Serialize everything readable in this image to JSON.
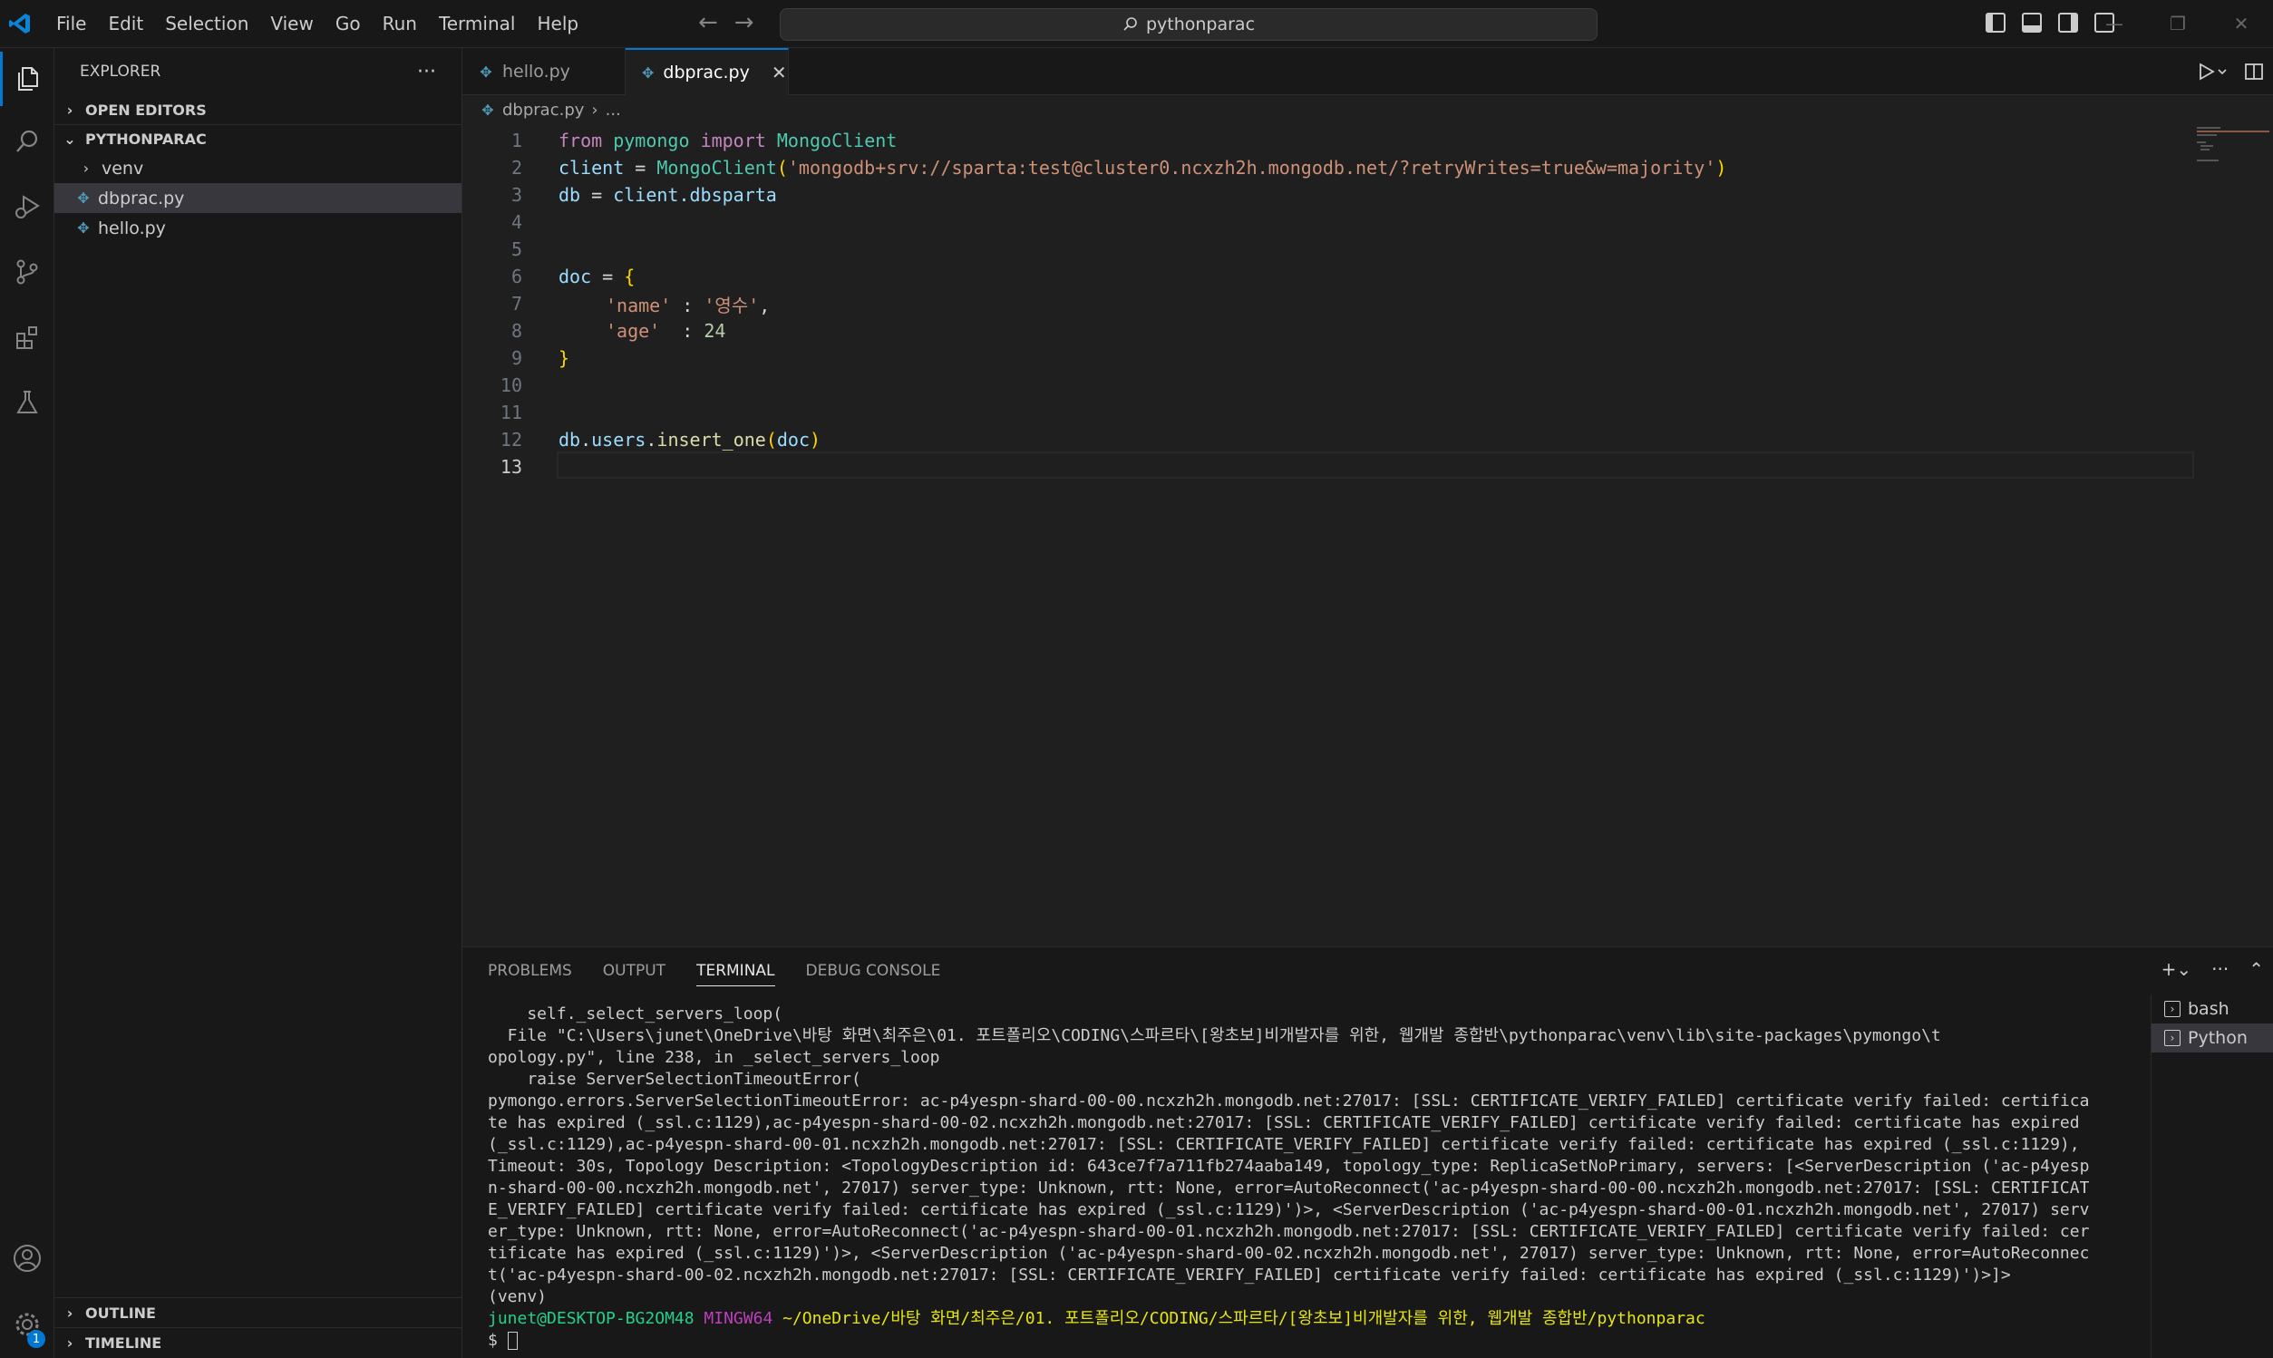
{
  "titlebar": {
    "menu": [
      "File",
      "Edit",
      "Selection",
      "View",
      "Go",
      "Run",
      "Terminal",
      "Help"
    ],
    "search_text": "pythonparac"
  },
  "sidebar": {
    "title": "EXPLORER",
    "open_editors": "OPEN EDITORS",
    "project": "PYTHONPARAC",
    "items": [
      {
        "label": "venv",
        "kind": "folder"
      },
      {
        "label": "dbprac.py",
        "kind": "file",
        "selected": true
      },
      {
        "label": "hello.py",
        "kind": "file"
      }
    ],
    "outline": "OUTLINE",
    "timeline": "TIMELINE"
  },
  "activity": {
    "badge_count": "1"
  },
  "tabs": [
    {
      "label": "hello.py",
      "active": false
    },
    {
      "label": "dbprac.py",
      "active": true
    }
  ],
  "breadcrumb": {
    "file": "dbprac.py",
    "rest": "..."
  },
  "editor": {
    "line_numbers": [
      "1",
      "2",
      "3",
      "4",
      "5",
      "6",
      "7",
      "8",
      "9",
      "10",
      "11",
      "12",
      "13"
    ],
    "current_line": 13,
    "l1": {
      "from": "from",
      "module": "pymongo",
      "import": "import",
      "name": "MongoClient"
    },
    "l2": {
      "var": "client",
      "eq": " = ",
      "fn": "MongoClient",
      "open": "(",
      "str": "'mongodb+srv://sparta:test@cluster0.ncxzh2h.mongodb.net/?retryWrites=true&w=majority'",
      "close": ")"
    },
    "l3": {
      "var": "db",
      "eq": " = ",
      "obj": "client",
      "attr": ".dbsparta"
    },
    "l6": {
      "var": "doc",
      "eq": " = ",
      "brace": "{"
    },
    "l7": {
      "key": "'name'",
      "sep": " : ",
      "val": "'영수'",
      "comma": ","
    },
    "l8": {
      "key": "'age'",
      "sep": "  : ",
      "val": "24"
    },
    "l9": {
      "brace": "}"
    },
    "l12": {
      "obj": "db",
      "dot1": ".",
      "attr": "users",
      "dot2": ".",
      "fn": "insert_one",
      "open": "(",
      "arg": "doc",
      "close": ")"
    }
  },
  "panel": {
    "tabs": [
      "PROBLEMS",
      "OUTPUT",
      "TERMINAL",
      "DEBUG CONSOLE"
    ],
    "active_tab": "TERMINAL",
    "terminal_lines": [
      "    self._select_servers_loop(",
      "  File \"C:\\Users\\junet\\OneDrive\\바탕 화면\\최주은\\01. 포트폴리오\\CODING\\스파르타\\[왕초보]비개발자를 위한, 웹개발 종합반\\pythonparac\\venv\\lib\\site-packages\\pymongo\\t",
      "opology.py\", line 238, in _select_servers_loop",
      "    raise ServerSelectionTimeoutError(",
      "pymongo.errors.ServerSelectionTimeoutError: ac-p4yespn-shard-00-00.ncxzh2h.mongodb.net:27017: [SSL: CERTIFICATE_VERIFY_FAILED] certificate verify failed: certifica",
      "te has expired (_ssl.c:1129),ac-p4yespn-shard-00-02.ncxzh2h.mongodb.net:27017: [SSL: CERTIFICATE_VERIFY_FAILED] certificate verify failed: certificate has expired",
      "(_ssl.c:1129),ac-p4yespn-shard-00-01.ncxzh2h.mongodb.net:27017: [SSL: CERTIFICATE_VERIFY_FAILED] certificate verify failed: certificate has expired (_ssl.c:1129),",
      "Timeout: 30s, Topology Description: <TopologyDescription id: 643ce7f7a711fb274aaba149, topology_type: ReplicaSetNoPrimary, servers: [<ServerDescription ('ac-p4yesp",
      "n-shard-00-00.ncxzh2h.mongodb.net', 27017) server_type: Unknown, rtt: None, error=AutoReconnect('ac-p4yespn-shard-00-00.ncxzh2h.mongodb.net:27017: [SSL: CERTIFICAT",
      "E_VERIFY_FAILED] certificate verify failed: certificate has expired (_ssl.c:1129)')>, <ServerDescription ('ac-p4yespn-shard-00-01.ncxzh2h.mongodb.net', 27017) serv",
      "er_type: Unknown, rtt: None, error=AutoReconnect('ac-p4yespn-shard-00-01.ncxzh2h.mongodb.net:27017: [SSL: CERTIFICATE_VERIFY_FAILED] certificate verify failed: cer",
      "tificate has expired (_ssl.c:1129)')>, <ServerDescription ('ac-p4yespn-shard-00-02.ncxzh2h.mongodb.net', 27017) server_type: Unknown, rtt: None, error=AutoReconnec",
      "t('ac-p4yespn-shard-00-02.ncxzh2h.mongodb.net:27017: [SSL: CERTIFICATE_VERIFY_FAILED] certificate verify failed: certificate has expired (_ssl.c:1129)')>]>",
      "(venv)"
    ],
    "prompt": {
      "user": "junet@DESKTOP-BG2OM48",
      "shell": "MINGW64",
      "path": "~/OneDrive/바탕 화면/최주은/01. 포트폴리오/CODING/스파르타/[왕초보]비개발자를 위한, 웹개발 종합반/pythonparac",
      "symbol": "$"
    },
    "terminals": [
      {
        "label": "bash",
        "active": false
      },
      {
        "label": "Python",
        "active": true
      }
    ]
  },
  "colors": {
    "accent": "#0078d4",
    "background": "#1f1f1f",
    "sidebar": "#181818"
  }
}
